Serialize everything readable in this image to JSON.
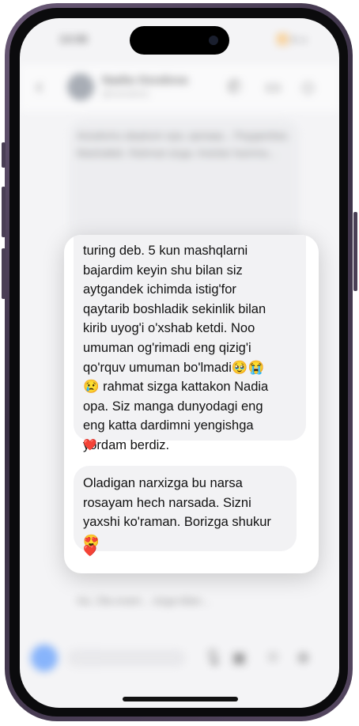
{
  "status_bar": {
    "time": "14:06",
    "icons": "📶 ▾ ▭"
  },
  "chat_header": {
    "back_icon": "‹",
    "name": "Nadia Ozodova",
    "subtitle": "@nozodova",
    "call_icon": "✆",
    "video_icon": "▭",
    "tag_icon": "◇"
  },
  "background_messages": {
    "top_text": "Assalomu alaykum opa, qanaqa... Paygambar, Mashallah. Rahmat sizga. Ketolar hamma...",
    "bottom_text": "Ha. Ota-onam... sizga bilan..."
  },
  "popup": {
    "messages": [
      {
        "text": "turing deb. 5 kun mashqlarni\nbajardim keyin shu bilan siz\naytgandek ichimda istig'for\nqaytarib boshladik sekinlik bilan\nkirib uyog'i o'xshab ketdi. Noo\numuman og'rimadi eng qizig'i\nqo'rquv umuman bo'lmadi🥹😭\n😢 rahmat sizga kattakon Nadia\nopa. Siz manga dunyodagi eng\neng katta dardimni yengishga\nyordam berdiz.",
        "reaction": "❤️"
      },
      {
        "text": "Oladigan narxizga bu narsa\nrosayam hech narsada. Sizni\nyaxshi ko'raman. Borizga shukur\n😍",
        "reaction": "❤️"
      }
    ]
  },
  "input_bar": {
    "placeholder": "Xabar yozing...",
    "camera_icon": "◉",
    "mic_icon": "🎙",
    "gallery_icon": "▣",
    "sticker_icon": "☺",
    "plus_icon": "⊕"
  }
}
